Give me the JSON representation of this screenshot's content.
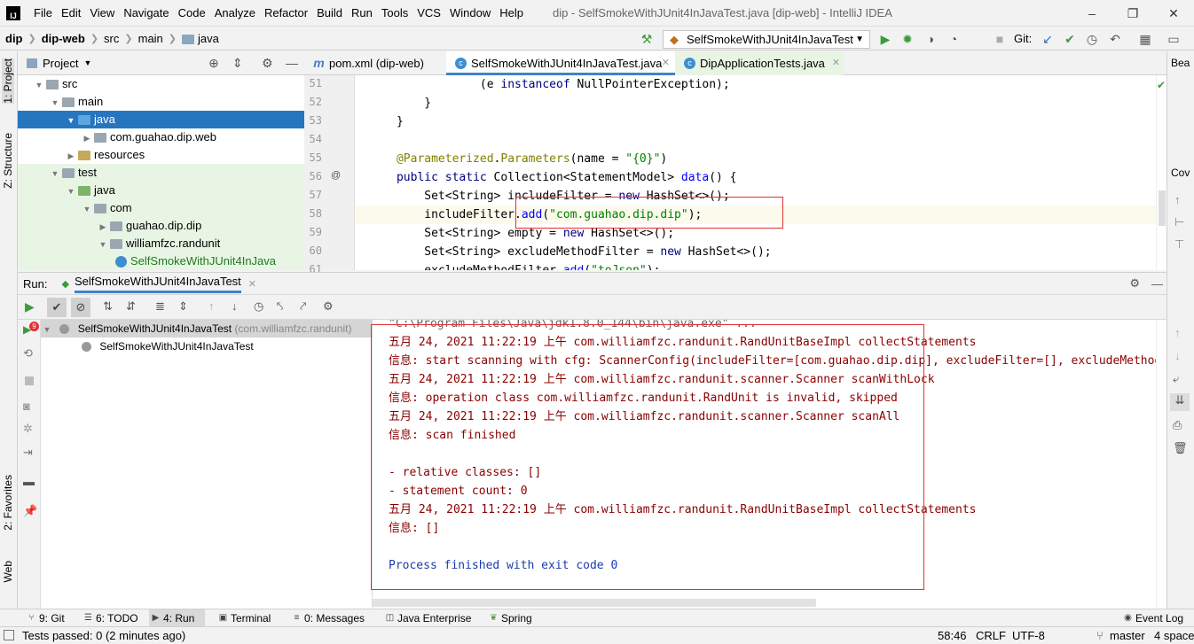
{
  "window": {
    "title": "dip - SelfSmokeWithJUnit4InJavaTest.java [dip-web] - IntelliJ IDEA",
    "controls": [
      "–",
      "❐",
      "✕"
    ]
  },
  "menu": [
    "File",
    "Edit",
    "View",
    "Navigate",
    "Code",
    "Analyze",
    "Refactor",
    "Build",
    "Run",
    "Tools",
    "VCS",
    "Window",
    "Help"
  ],
  "breadcrumb": [
    "dip",
    "dip-web",
    "src",
    "main",
    "java"
  ],
  "run_config": "SelfSmokeWithJUnit4InJavaTest",
  "git_label": "Git:",
  "left_tabs": {
    "project": "1: Project",
    "structure": "Z: Structure",
    "favorites": "2: Favorites",
    "web": "Web"
  },
  "project_panel": {
    "title": "Project",
    "tree": [
      {
        "label": "src",
        "depth": 2,
        "expanded": true,
        "kind": "folder"
      },
      {
        "label": "main",
        "depth": 3,
        "expanded": true,
        "kind": "folder"
      },
      {
        "label": "java",
        "depth": 4,
        "expanded": true,
        "kind": "src",
        "selected": true
      },
      {
        "label": "com.guahao.dip.web",
        "depth": 5,
        "expanded": false,
        "kind": "folder"
      },
      {
        "label": "resources",
        "depth": 4,
        "expanded": false,
        "kind": "res"
      },
      {
        "label": "test",
        "depth": 3,
        "expanded": true,
        "kind": "folder"
      },
      {
        "label": "java",
        "depth": 4,
        "expanded": true,
        "kind": "test"
      },
      {
        "label": "com",
        "depth": 5,
        "expanded": true,
        "kind": "folder"
      },
      {
        "label": "guahao.dip.dip",
        "depth": 6,
        "expanded": false,
        "kind": "folder"
      },
      {
        "label": "williamfzc.randunit",
        "depth": 6,
        "expanded": true,
        "kind": "folder"
      },
      {
        "label": "SelfSmokeWithJUnit4InJava",
        "depth": 7,
        "kind": "class"
      }
    ]
  },
  "editor_tabs": [
    {
      "label": "pom.xml (dip-web)",
      "icon": "m"
    },
    {
      "label": "SelfSmokeWithJUnit4InJavaTest.java",
      "icon": "c",
      "active": true
    },
    {
      "label": "DipApplicationTests.java",
      "icon": "c"
    }
  ],
  "code": {
    "line_numbers": [
      "51",
      "52",
      "53",
      "54",
      "55",
      "56",
      "57",
      "58",
      "59",
      "60",
      "61"
    ],
    "lines": [
      "                (e instanceof NullPointerException);",
      "        }",
      "    }",
      "",
      "    @Parameterized.Parameters(name = \"{0}\")",
      "    public static Collection<StatementModel> data() {",
      "        Set<String> includeFilter = new HashSet<>();",
      "        includeFilter.add(\"com.guahao.dip.dip\");",
      "        Set<String> empty = new HashSet<>();",
      "        Set<String> excludeMethodFilter = new HashSet<>();",
      "        excludeMethodFilter.add(\"toJson\");"
    ]
  },
  "right_tabs": {
    "bean": "Bea",
    "coverage": "Cov"
  },
  "run_panel": {
    "label": "Run:",
    "tab": "SelfSmokeWithJUnit4InJavaTest",
    "badge": "9",
    "test_root": "SelfSmokeWithJUnit4InJavaTest",
    "test_root_pkg": "(com.williamfzc.randunit)",
    "test_child": "SelfSmokeWithJUnit4InJavaTest"
  },
  "console": [
    {
      "text": "\"C:\\Program Files\\Java\\jdk1.8.0_144\\bin\\java.exe\" ...",
      "style": "gray"
    },
    {
      "text": "五月 24, 2021 11:22:19 上午 com.williamfzc.randunit.RandUnitBaseImpl collectStatements",
      "style": "red"
    },
    {
      "text": "信息: start scanning with cfg: ScannerConfig(includeFilter=[com.guahao.dip.dip], excludeFilter=[], excludeMethodFilter=[toJson])",
      "style": "red"
    },
    {
      "text": "五月 24, 2021 11:22:19 上午 com.williamfzc.randunit.scanner.Scanner scanWithLock",
      "style": "red"
    },
    {
      "text": "信息: operation class com.williamfzc.randunit.RandUnit is invalid, skipped",
      "style": "red"
    },
    {
      "text": "五月 24, 2021 11:22:19 上午 com.williamfzc.randunit.scanner.Scanner scanAll",
      "style": "red"
    },
    {
      "text": "信息: scan finished",
      "style": "red"
    },
    {
      "text": "",
      "style": "red"
    },
    {
      "text": "- relative classes: []",
      "style": "red"
    },
    {
      "text": "- statement count: 0",
      "style": "red"
    },
    {
      "text": "五月 24, 2021 11:22:19 上午 com.williamfzc.randunit.RandUnitBaseImpl collectStatements",
      "style": "red"
    },
    {
      "text": "信息: []",
      "style": "red"
    },
    {
      "text": "",
      "style": "red"
    },
    {
      "text": "Process finished with exit code 0",
      "style": "blue"
    }
  ],
  "bottom_tabs": [
    {
      "label": "9: Git",
      "icon": "⑂"
    },
    {
      "label": "6: TODO",
      "icon": "☰"
    },
    {
      "label": "4: Run",
      "icon": "▶",
      "active": true
    },
    {
      "label": "Terminal",
      "icon": "▣"
    },
    {
      "label": "0: Messages",
      "icon": "≡"
    },
    {
      "label": "Java Enterprise",
      "icon": "◫"
    },
    {
      "label": "Spring",
      "icon": "❦"
    }
  ],
  "event_log": "Event Log",
  "status": {
    "left": "Tests passed: 0 (2 minutes ago)",
    "position": "58:46",
    "line_sep": "CRLF",
    "encoding": "UTF-8",
    "branch": "master",
    "indent": "4 space"
  },
  "colors": {
    "selection": "#2675bf",
    "console_error": "#8b0000",
    "console_info": "#1a3cad",
    "highlight_box": "#e03030"
  }
}
